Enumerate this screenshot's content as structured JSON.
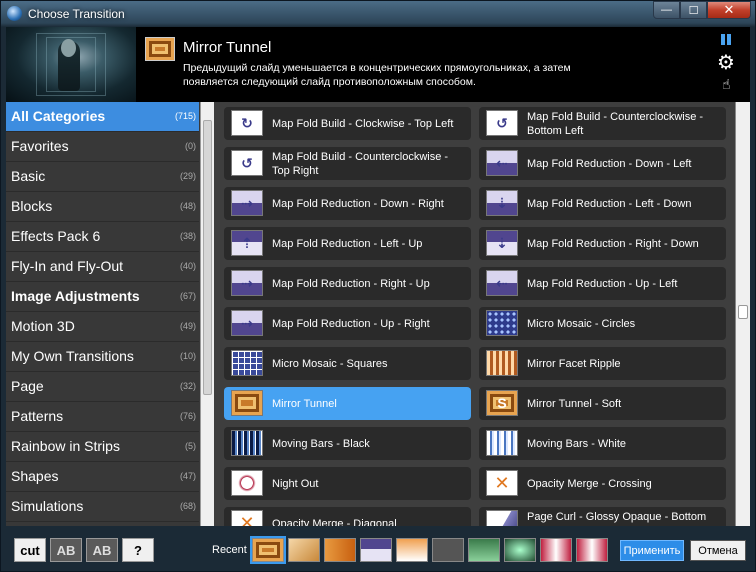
{
  "window": {
    "title": "Choose Transition"
  },
  "header": {
    "transition_name": "Mirror Tunnel",
    "description": "Предыдущий слайд уменьшается в концентрических прямоугольниках, а затем появляется следующий слайд противоположным способом."
  },
  "categories": [
    {
      "label": "All Categories",
      "count": "(715)",
      "bold": true,
      "selected": true
    },
    {
      "label": "Favorites",
      "count": "(0)"
    },
    {
      "label": "Basic",
      "count": "(29)"
    },
    {
      "label": "Blocks",
      "count": "(48)"
    },
    {
      "label": "Effects Pack 6",
      "count": "(38)"
    },
    {
      "label": "Fly-In and Fly-Out",
      "count": "(40)"
    },
    {
      "label": "Image Adjustments",
      "count": "(67)",
      "bold": true
    },
    {
      "label": "Motion 3D",
      "count": "(49)"
    },
    {
      "label": "My Own Transitions",
      "count": "(10)"
    },
    {
      "label": "Page",
      "count": "(32)"
    },
    {
      "label": "Patterns",
      "count": "(76)"
    },
    {
      "label": "Rainbow in Strips",
      "count": "(5)"
    },
    {
      "label": "Shapes",
      "count": "(47)"
    },
    {
      "label": "Simulations",
      "count": "(68)"
    }
  ],
  "transitions": [
    {
      "name": "Map Fold Build - Clockwise - Top Left",
      "icon": "fold-clockwise-icon",
      "thumb": "t-white",
      "glyph": "↻"
    },
    {
      "name": "Map Fold Build - Counterclockwise - Bottom Left",
      "icon": "fold-counterclockwise-icon",
      "thumb": "t-white",
      "glyph": "↺"
    },
    {
      "name": "Map Fold Build - Counterclockwise - Top Right",
      "icon": "fold-counterclockwise-icon",
      "thumb": "t-white",
      "glyph": "↺"
    },
    {
      "name": "Map Fold Reduction - Down - Left",
      "icon": "fold-reduction-icon",
      "thumb": "t-purple",
      "glyph": "⇠"
    },
    {
      "name": "Map Fold Reduction - Down - Right",
      "icon": "fold-reduction-icon",
      "thumb": "t-purple",
      "glyph": "⇢"
    },
    {
      "name": "Map Fold Reduction - Left - Down",
      "icon": "fold-reduction-icon",
      "thumb": "t-purple",
      "glyph": "⇣"
    },
    {
      "name": "Map Fold Reduction - Left - Up",
      "icon": "fold-reduction-icon",
      "thumb": "t-purple2",
      "glyph": "⇡"
    },
    {
      "name": "Map Fold Reduction - Right - Down",
      "icon": "fold-reduction-icon",
      "thumb": "t-purple2",
      "glyph": "⇣"
    },
    {
      "name": "Map Fold Reduction - Right - Up",
      "icon": "fold-reduction-icon",
      "thumb": "t-purple",
      "glyph": "⇢"
    },
    {
      "name": "Map Fold Reduction - Up - Left",
      "icon": "fold-reduction-icon",
      "thumb": "t-purple",
      "glyph": "⇠"
    },
    {
      "name": "Map Fold Reduction - Up - Right",
      "icon": "fold-reduction-icon",
      "thumb": "t-purple",
      "glyph": "⇢"
    },
    {
      "name": "Micro Mosaic - Circles",
      "icon": "mosaic-circles-icon",
      "thumb": "t-mosaic-c",
      "glyph": ""
    },
    {
      "name": "Micro Mosaic - Squares",
      "icon": "mosaic-squares-icon",
      "thumb": "t-mosaic-s",
      "glyph": ""
    },
    {
      "name": "Mirror Facet Ripple",
      "icon": "facet-ripple-icon",
      "thumb": "t-facet",
      "glyph": ""
    },
    {
      "name": "Mirror Tunnel",
      "icon": "mirror-tunnel-icon",
      "thumb": "t-tunnel",
      "glyph": "",
      "selected": true
    },
    {
      "name": "Mirror Tunnel - Soft",
      "icon": "mirror-tunnel-soft-icon",
      "thumb": "t-tunnel",
      "glyph": "S"
    },
    {
      "name": "Moving Bars - Black",
      "icon": "moving-bars-icon",
      "thumb": "t-bars-b",
      "glyph": ""
    },
    {
      "name": "Moving Bars - White",
      "icon": "moving-bars-icon",
      "thumb": "t-bars-w",
      "glyph": ""
    },
    {
      "name": "Night Out",
      "icon": "night-out-icon",
      "thumb": "t-night",
      "glyph": ""
    },
    {
      "name": "Opacity Merge - Crossing",
      "icon": "opacity-merge-icon",
      "thumb": "t-opacity",
      "glyph": "✕"
    },
    {
      "name": "Opacity Merge - Diagonal",
      "icon": "opacity-merge-icon",
      "thumb": "t-opacity",
      "glyph": "✕"
    },
    {
      "name": "Page Curl - Glossy Opaque - Bottom Left",
      "icon": "page-curl-icon",
      "thumb": "t-curl",
      "glyph": ""
    }
  ],
  "bottom": {
    "tool_buttons": [
      {
        "label": "cut",
        "name": "cut-button"
      },
      {
        "label": "AB",
        "name": "ab-button-1"
      },
      {
        "label": "AB",
        "name": "ab-button-2"
      },
      {
        "label": "?",
        "name": "help-button"
      }
    ],
    "recent_label": "Recent",
    "apply_label": "Применить",
    "cancel_label": "Отмена"
  },
  "colors": {
    "accent": "#46a2f2",
    "selection": "#3d8de0",
    "tile_bg": "#2a2a2a"
  }
}
